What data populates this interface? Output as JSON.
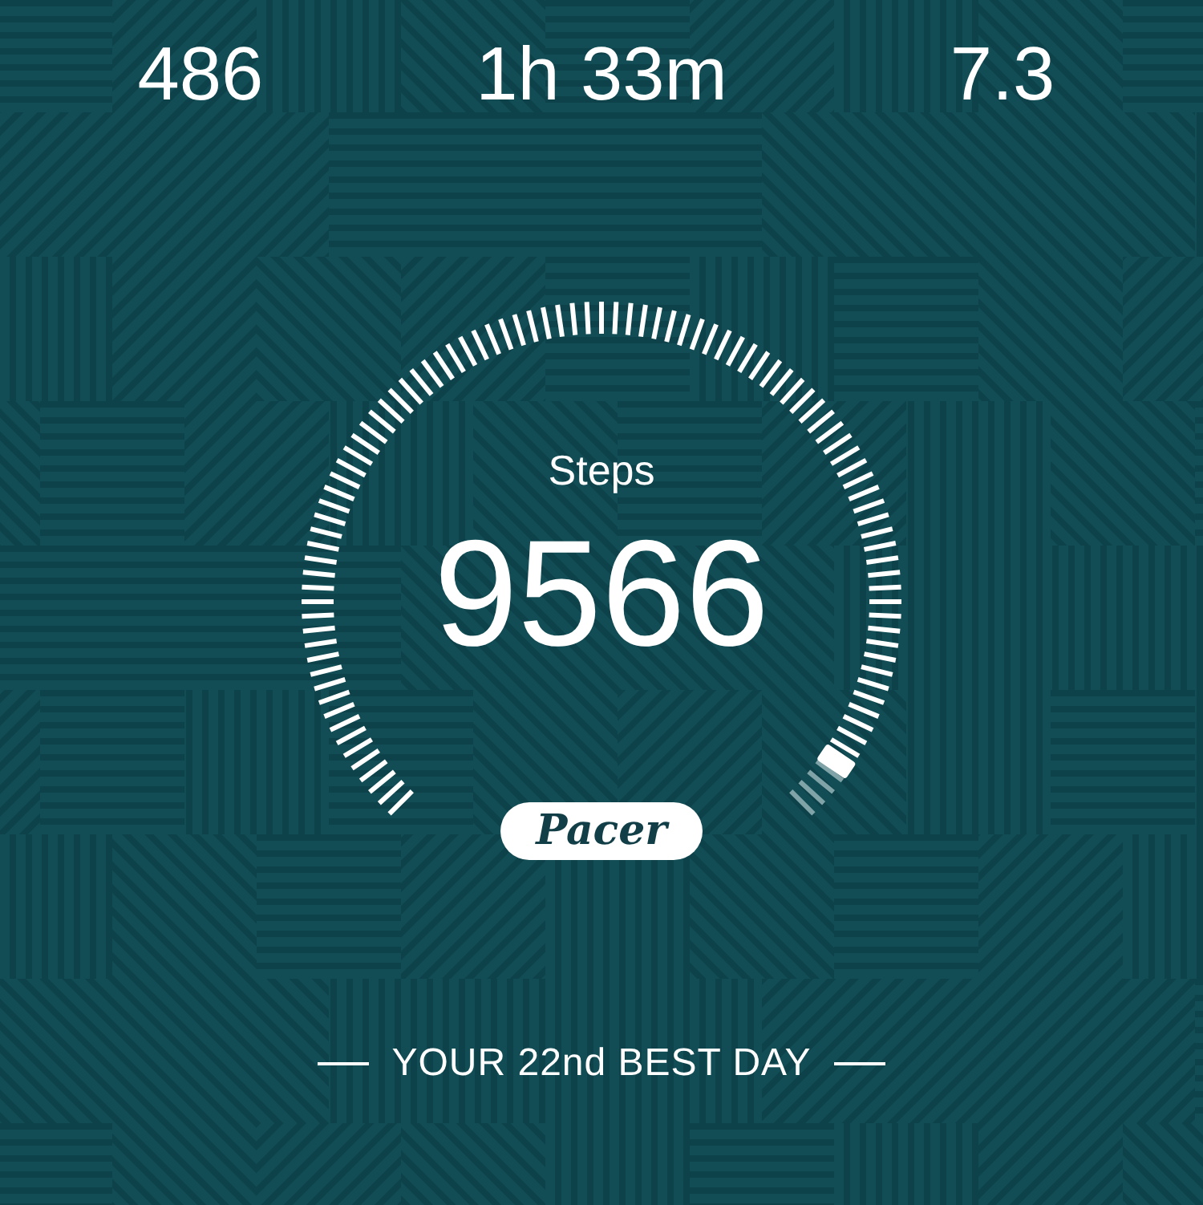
{
  "stats": [
    {
      "value": "486"
    },
    {
      "value": "1h 33m"
    },
    {
      "value": "7.3"
    }
  ],
  "gauge": {
    "label": "Steps",
    "value": "9566"
  },
  "logo": "Pacer",
  "best_day": "YOUR 22nd BEST DAY"
}
